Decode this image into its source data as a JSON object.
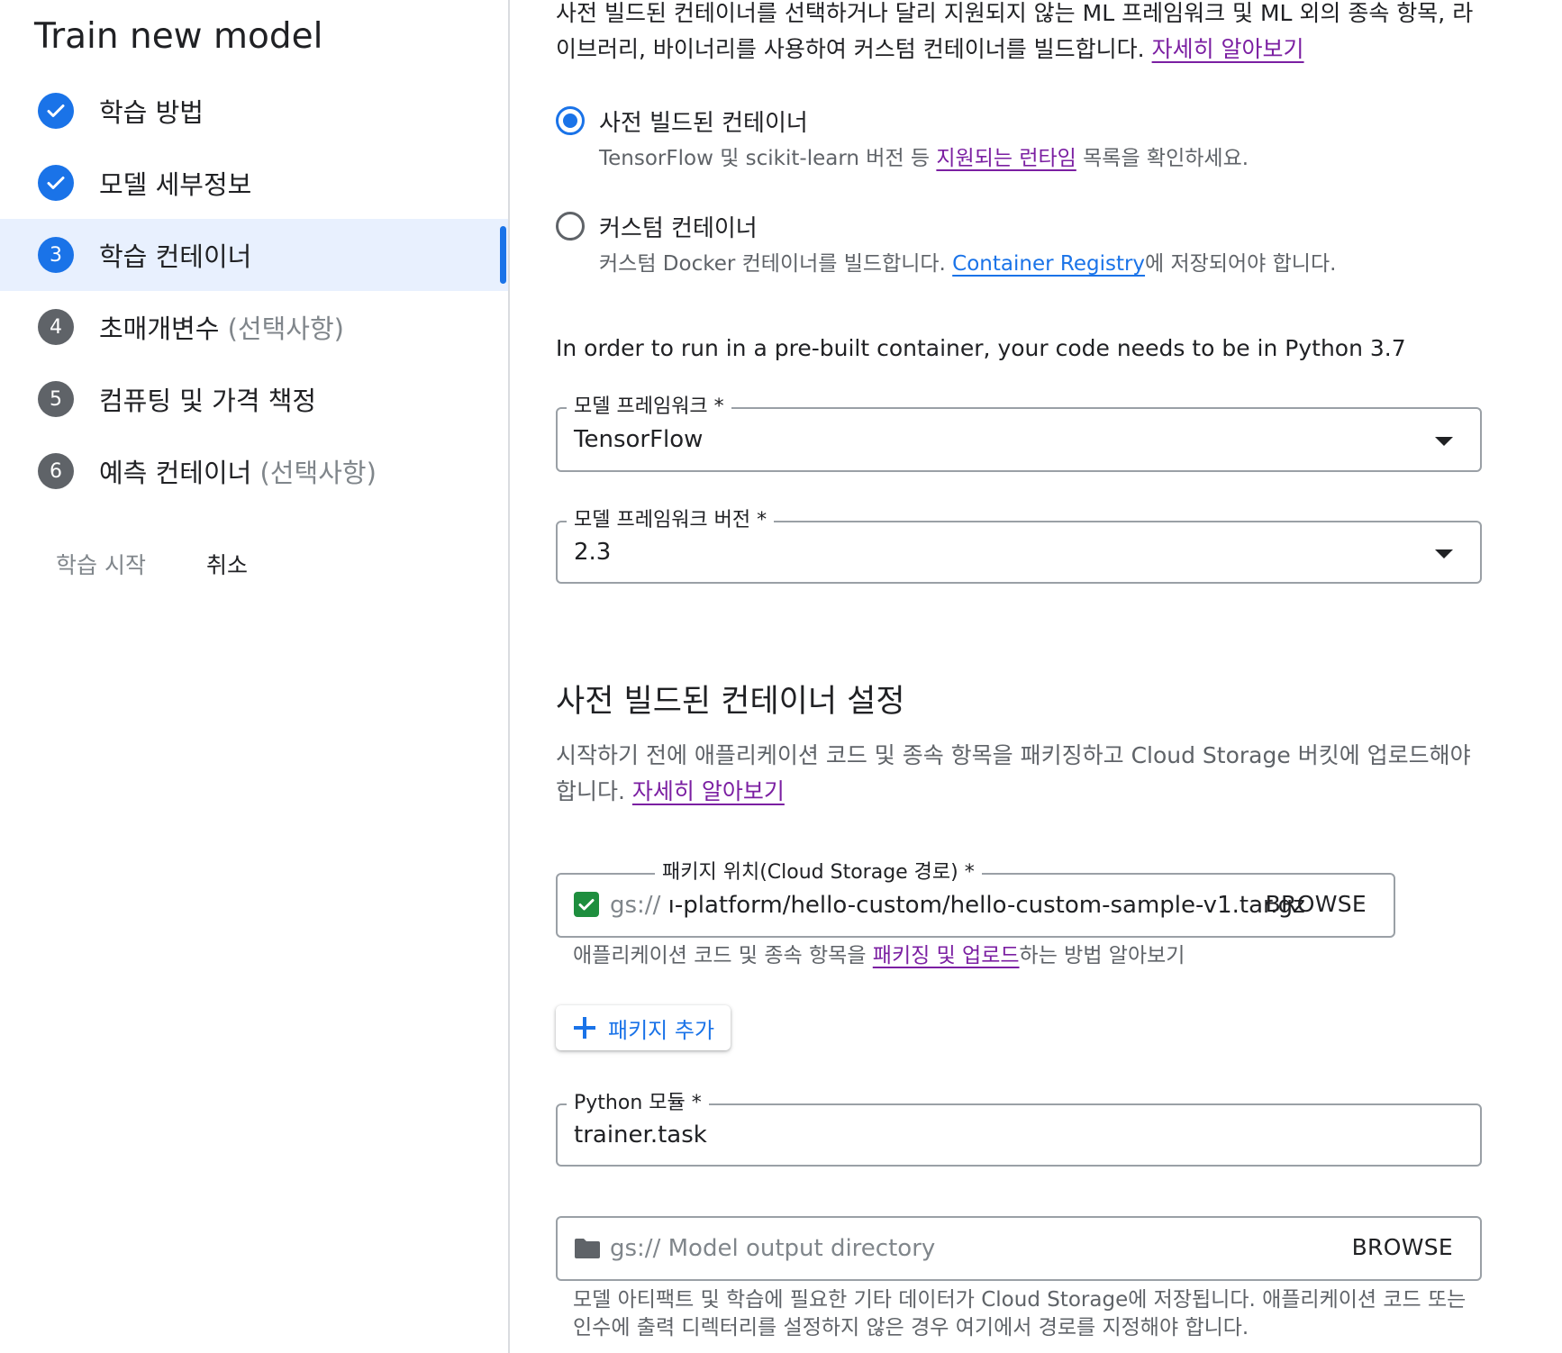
{
  "sidebar": {
    "title": "Train new model",
    "steps": [
      {
        "num": "",
        "label": "학습 방법",
        "optional": "",
        "state": "done"
      },
      {
        "num": "",
        "label": "모델 세부정보",
        "optional": "",
        "state": "done"
      },
      {
        "num": "3",
        "label": "학습 컨테이너",
        "optional": "",
        "state": "current"
      },
      {
        "num": "4",
        "label": "초매개변수",
        "optional": "(선택사항)",
        "state": "todo"
      },
      {
        "num": "5",
        "label": "컴퓨팅 및 가격 책정",
        "optional": "",
        "state": "todo"
      },
      {
        "num": "6",
        "label": "예측 컨테이너",
        "optional": "(선택사항)",
        "state": "todo"
      }
    ],
    "start_label": "학습 시작",
    "cancel_label": "취소"
  },
  "intro": {
    "text": "사전 빌드된 컨테이너를 선택하거나 달리 지원되지 않는 ML 프레임워크 및 ML 외의 종속 항목, 라이브러리, 바이너리를 사용하여 커스텀 컨테이너를 빌드합니다.",
    "link": "자세히 알아보기"
  },
  "container_options": {
    "prebuilt": {
      "title": "사전 빌드된 컨테이너",
      "sub_before": "TensorFlow 및 scikit-learn 버전 등 ",
      "sub_link": "지원되는 런타임",
      "sub_after": " 목록을 확인하세요.",
      "selected": true
    },
    "custom": {
      "title": "커스텀 컨테이너",
      "sub_before": "커스텀 Docker 컨테이너를 빌드합니다. ",
      "sub_link": "Container Registry",
      "sub_after": "에 저장되어야 합니다.",
      "selected": false
    }
  },
  "python_note": "In order to run in a pre-built container, your code needs to be in Python 3.7",
  "framework": {
    "label": "모델 프레임워크 *",
    "value": "TensorFlow"
  },
  "framework_version": {
    "label": "모델 프레임워크 버전 *",
    "value": "2.3"
  },
  "prebuilt_settings": {
    "title": "사전 빌드된 컨테이너 설정",
    "desc": "시작하기 전에 애플리케이션 코드 및 종속 항목을 패키징하고 Cloud Storage 버킷에 업로드해야 합니다.",
    "link": "자세히 알아보기"
  },
  "package": {
    "label": "패키지 위치(Cloud Storage 경로) *",
    "prefix": "gs://",
    "value": "ı-platform/hello-custom/hello-custom-sample-v1.tar.gz",
    "browse": "BROWSE",
    "hint_before": "애플리케이션 코드 및 종속 항목을 ",
    "hint_link": "패키징 및 업로드",
    "hint_after": "하는 방법 알아보기"
  },
  "add_package_label": "패키지 추가",
  "python_module": {
    "label": "Python 모듈 *",
    "value": "trainer.task"
  },
  "output_dir": {
    "prefix": "gs://",
    "placeholder": "Model output directory",
    "browse": "BROWSE",
    "hint": "모델 아티팩트 및 학습에 필요한 기타 데이터가 Cloud Storage에 저장됩니다. 애플리케이션 코드 또는 인수에 출력 디렉터리를 설정하지 않은 경우 여기에서 경로를 지정해야 합니다."
  },
  "colors": {
    "accent": "#1a73e8",
    "link_visited": "#7b1fa2",
    "success": "#1e8e3e"
  }
}
